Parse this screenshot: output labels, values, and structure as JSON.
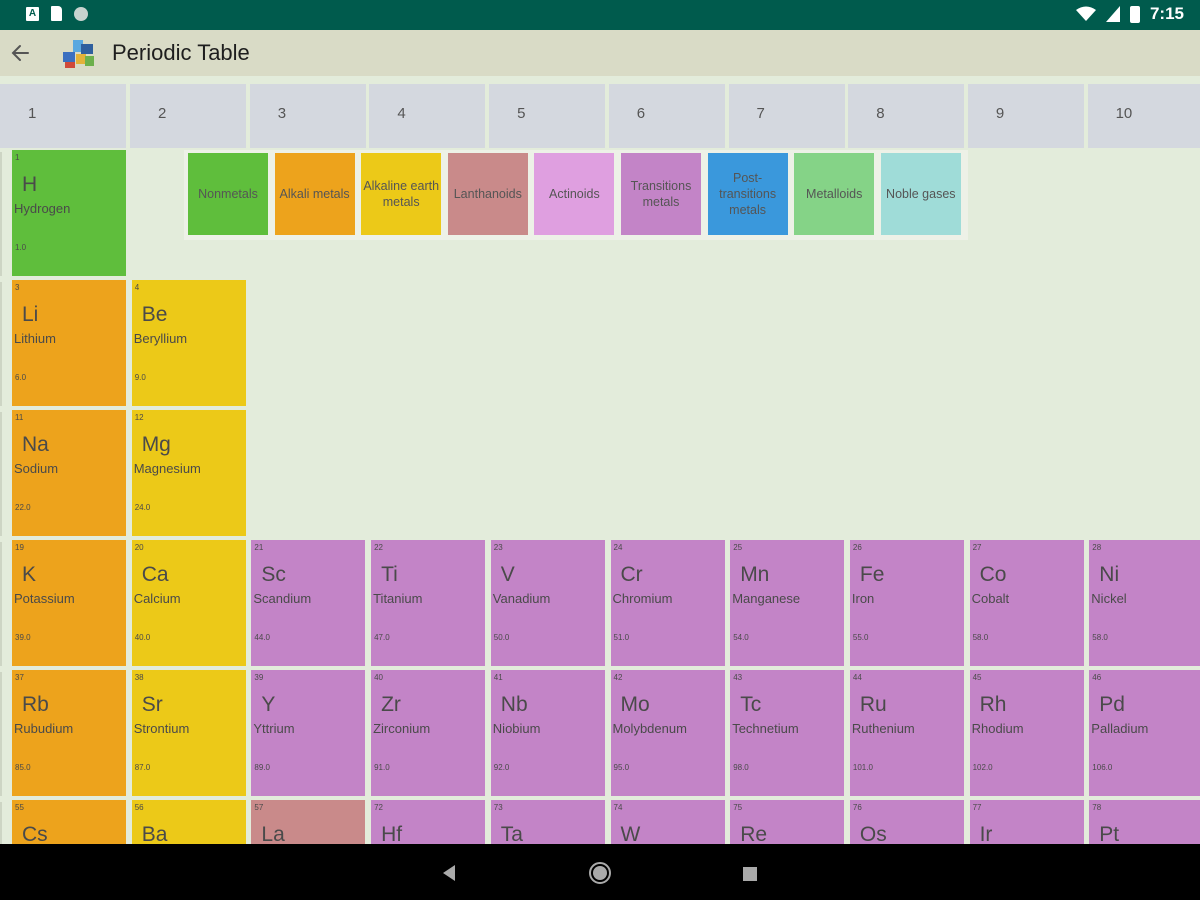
{
  "status_bar": {
    "time": "7:15"
  },
  "app_bar": {
    "title": "Periodic Table"
  },
  "groups": [
    "1",
    "2",
    "3",
    "4",
    "5",
    "6",
    "7",
    "8",
    "9",
    "10"
  ],
  "legend": [
    {
      "label": "Nonmetals",
      "color": "#5fbe3c"
    },
    {
      "label": "Alkali metals",
      "color": "#eda31c"
    },
    {
      "label": "Alkaline earth metals",
      "color": "#ecc918"
    },
    {
      "label": "Lanthanoids",
      "color": "#c98a8a"
    },
    {
      "label": "Actinoids",
      "color": "#df9fe0"
    },
    {
      "label": "Transitions metals",
      "color": "#c384c7"
    },
    {
      "label": "Post-transitions metals",
      "color": "#3a98dc"
    },
    {
      "label": "Metalloids",
      "color": "#85d387"
    },
    {
      "label": "Noble gases",
      "color": "#9fdcd8"
    }
  ],
  "elements": [
    {
      "num": "1",
      "sym": "H",
      "name": "Hydrogen",
      "mass": "1.0",
      "cat": 0,
      "col": 0,
      "row": 0
    },
    {
      "num": "3",
      "sym": "Li",
      "name": "Lithium",
      "mass": "6.0",
      "cat": 1,
      "col": 0,
      "row": 1
    },
    {
      "num": "4",
      "sym": "Be",
      "name": "Beryllium",
      "mass": "9.0",
      "cat": 2,
      "col": 1,
      "row": 1
    },
    {
      "num": "11",
      "sym": "Na",
      "name": "Sodium",
      "mass": "22.0",
      "cat": 1,
      "col": 0,
      "row": 2
    },
    {
      "num": "12",
      "sym": "Mg",
      "name": "Magnesium",
      "mass": "24.0",
      "cat": 2,
      "col": 1,
      "row": 2
    },
    {
      "num": "19",
      "sym": "K",
      "name": "Potassium",
      "mass": "39.0",
      "cat": 1,
      "col": 0,
      "row": 3
    },
    {
      "num": "20",
      "sym": "Ca",
      "name": "Calcium",
      "mass": "40.0",
      "cat": 2,
      "col": 1,
      "row": 3
    },
    {
      "num": "21",
      "sym": "Sc",
      "name": "Scandium",
      "mass": "44.0",
      "cat": 5,
      "col": 2,
      "row": 3
    },
    {
      "num": "22",
      "sym": "Ti",
      "name": "Titanium",
      "mass": "47.0",
      "cat": 5,
      "col": 3,
      "row": 3
    },
    {
      "num": "23",
      "sym": "V",
      "name": "Vanadium",
      "mass": "50.0",
      "cat": 5,
      "col": 4,
      "row": 3
    },
    {
      "num": "24",
      "sym": "Cr",
      "name": "Chromium",
      "mass": "51.0",
      "cat": 5,
      "col": 5,
      "row": 3
    },
    {
      "num": "25",
      "sym": "Mn",
      "name": "Manganese",
      "mass": "54.0",
      "cat": 5,
      "col": 6,
      "row": 3
    },
    {
      "num": "26",
      "sym": "Fe",
      "name": "Iron",
      "mass": "55.0",
      "cat": 5,
      "col": 7,
      "row": 3
    },
    {
      "num": "27",
      "sym": "Co",
      "name": "Cobalt",
      "mass": "58.0",
      "cat": 5,
      "col": 8,
      "row": 3
    },
    {
      "num": "28",
      "sym": "Ni",
      "name": "Nickel",
      "mass": "58.0",
      "cat": 5,
      "col": 9,
      "row": 3
    },
    {
      "num": "37",
      "sym": "Rb",
      "name": "Rubudium",
      "mass": "85.0",
      "cat": 1,
      "col": 0,
      "row": 4
    },
    {
      "num": "38",
      "sym": "Sr",
      "name": "Strontium",
      "mass": "87.0",
      "cat": 2,
      "col": 1,
      "row": 4
    },
    {
      "num": "39",
      "sym": "Y",
      "name": "Yttrium",
      "mass": "89.0",
      "cat": 5,
      "col": 2,
      "row": 4
    },
    {
      "num": "40",
      "sym": "Zr",
      "name": "Zirconium",
      "mass": "91.0",
      "cat": 5,
      "col": 3,
      "row": 4
    },
    {
      "num": "41",
      "sym": "Nb",
      "name": "Niobium",
      "mass": "92.0",
      "cat": 5,
      "col": 4,
      "row": 4
    },
    {
      "num": "42",
      "sym": "Mo",
      "name": "Molybdenum",
      "mass": "95.0",
      "cat": 5,
      "col": 5,
      "row": 4
    },
    {
      "num": "43",
      "sym": "Tc",
      "name": "Technetium",
      "mass": "98.0",
      "cat": 5,
      "col": 6,
      "row": 4
    },
    {
      "num": "44",
      "sym": "Ru",
      "name": "Ruthenium",
      "mass": "101.0",
      "cat": 5,
      "col": 7,
      "row": 4
    },
    {
      "num": "45",
      "sym": "Rh",
      "name": "Rhodium",
      "mass": "102.0",
      "cat": 5,
      "col": 8,
      "row": 4
    },
    {
      "num": "46",
      "sym": "Pd",
      "name": "Palladium",
      "mass": "106.0",
      "cat": 5,
      "col": 9,
      "row": 4
    },
    {
      "num": "55",
      "sym": "Cs",
      "name": "",
      "mass": "",
      "cat": 1,
      "col": 0,
      "row": 5
    },
    {
      "num": "56",
      "sym": "Ba",
      "name": "",
      "mass": "",
      "cat": 2,
      "col": 1,
      "row": 5
    },
    {
      "num": "57",
      "sym": "La",
      "name": "",
      "mass": "",
      "cat": 3,
      "col": 2,
      "row": 5
    },
    {
      "num": "72",
      "sym": "Hf",
      "name": "",
      "mass": "",
      "cat": 5,
      "col": 3,
      "row": 5
    },
    {
      "num": "73",
      "sym": "Ta",
      "name": "",
      "mass": "",
      "cat": 5,
      "col": 4,
      "row": 5
    },
    {
      "num": "74",
      "sym": "W",
      "name": "",
      "mass": "",
      "cat": 5,
      "col": 5,
      "row": 5
    },
    {
      "num": "75",
      "sym": "Re",
      "name": "",
      "mass": "",
      "cat": 5,
      "col": 6,
      "row": 5
    },
    {
      "num": "76",
      "sym": "Os",
      "name": "",
      "mass": "",
      "cat": 5,
      "col": 7,
      "row": 5
    },
    {
      "num": "77",
      "sym": "Ir",
      "name": "",
      "mass": "",
      "cat": 5,
      "col": 8,
      "row": 5
    },
    {
      "num": "78",
      "sym": "Pt",
      "name": "",
      "mass": "",
      "cat": 5,
      "col": 9,
      "row": 5
    }
  ]
}
